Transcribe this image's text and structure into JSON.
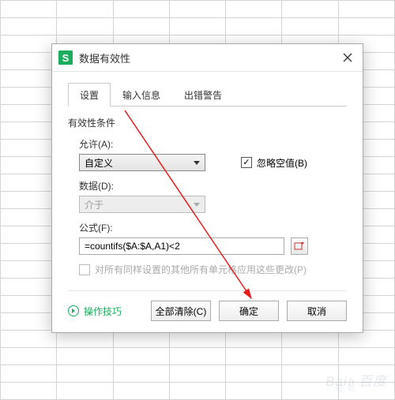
{
  "dialog": {
    "title": "数据有效性",
    "app_icon_letter": "S"
  },
  "tabs": {
    "settings": "设置",
    "input_msg": "输入信息",
    "error_alert": "出错警告"
  },
  "labels": {
    "condition": "有效性条件",
    "allow": "允许(A):",
    "data": "数据(D):",
    "formula": "公式(F):",
    "ignore_blank": "忽略空值(B)",
    "apply_all": "对所有同样设置的其他所有单元格应用这些更改(P)"
  },
  "fields": {
    "allow_value": "自定义",
    "data_value": "介于",
    "formula_value": "=countifs($A:$A,A1)<2"
  },
  "footer": {
    "tips": "操作技巧",
    "clear_all": "全部清除(C)",
    "ok": "确定",
    "cancel": "取消"
  }
}
